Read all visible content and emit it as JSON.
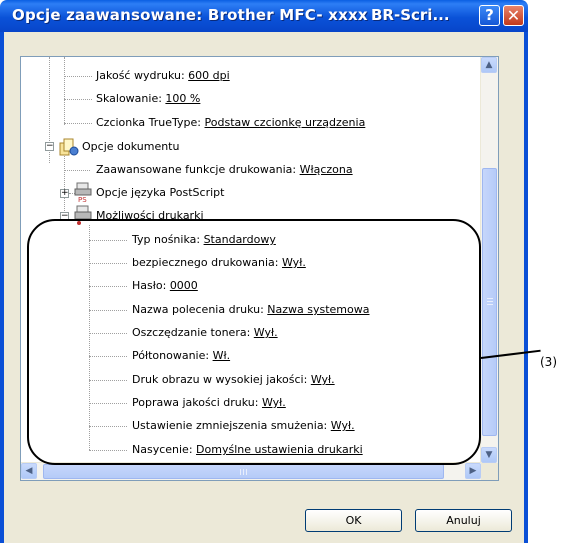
{
  "window": {
    "title": "Opcje zaawansowane: Brother MFC- xxxx",
    "title_right": "BR-Scri...",
    "help_glyph": "?",
    "close_glyph": "✕",
    "colors": {
      "titlebar": "#0a52d8",
      "frame": "#0a4fd6",
      "dialog_bg": "#ece9d8",
      "close": "#c2391b"
    }
  },
  "tree": {
    "items": [
      {
        "label": "Jakość wydruku: ",
        "value": "600 dpi"
      },
      {
        "label": "Skalowanie: ",
        "value": "100 %"
      },
      {
        "label": "Czcionka TrueType: ",
        "value": "Podstaw czcionkę urządzenia"
      },
      {
        "label": "Opcje dokumentu",
        "value": "",
        "icon": "documents-icon",
        "expander": "−"
      },
      {
        "label": "Zaawansowane funkcje drukowania: ",
        "value": "Włączona"
      },
      {
        "label": "Opcje języka PostScript",
        "value": "",
        "icon": "postscript-printer-icon",
        "expander": "+"
      },
      {
        "label": "Możliwości drukarki",
        "value": "",
        "icon": "printer-icon",
        "expander": "−"
      },
      {
        "label": "Typ nośnika: ",
        "value": "Standardowy"
      },
      {
        "label": "bezpiecznego drukowania: ",
        "value": "Wył."
      },
      {
        "label": "Hasło: ",
        "value": "0000"
      },
      {
        "label": "Nazwa polecenia druku: ",
        "value": "Nazwa systemowa"
      },
      {
        "label": "Oszczędzanie tonera: ",
        "value": "Wył."
      },
      {
        "label": "Półtonowanie: ",
        "value": "Wł."
      },
      {
        "label": "Druk obrazu w wysokiej jakości: ",
        "value": "Wył."
      },
      {
        "label": "Poprawa jakości druku: ",
        "value": "Wył."
      },
      {
        "label": "Ustawienie zmniejszenia smużenia: ",
        "value": "Wył."
      },
      {
        "label": "Nasycenie: ",
        "value": "Domyślne ustawienia drukarki"
      }
    ]
  },
  "scrollbar": {
    "up": "▲",
    "down": "▼",
    "left": "◀",
    "right": "▶"
  },
  "buttons": {
    "ok": "OK",
    "cancel": "Anuluj"
  },
  "annotation": {
    "callout": "(3)"
  }
}
